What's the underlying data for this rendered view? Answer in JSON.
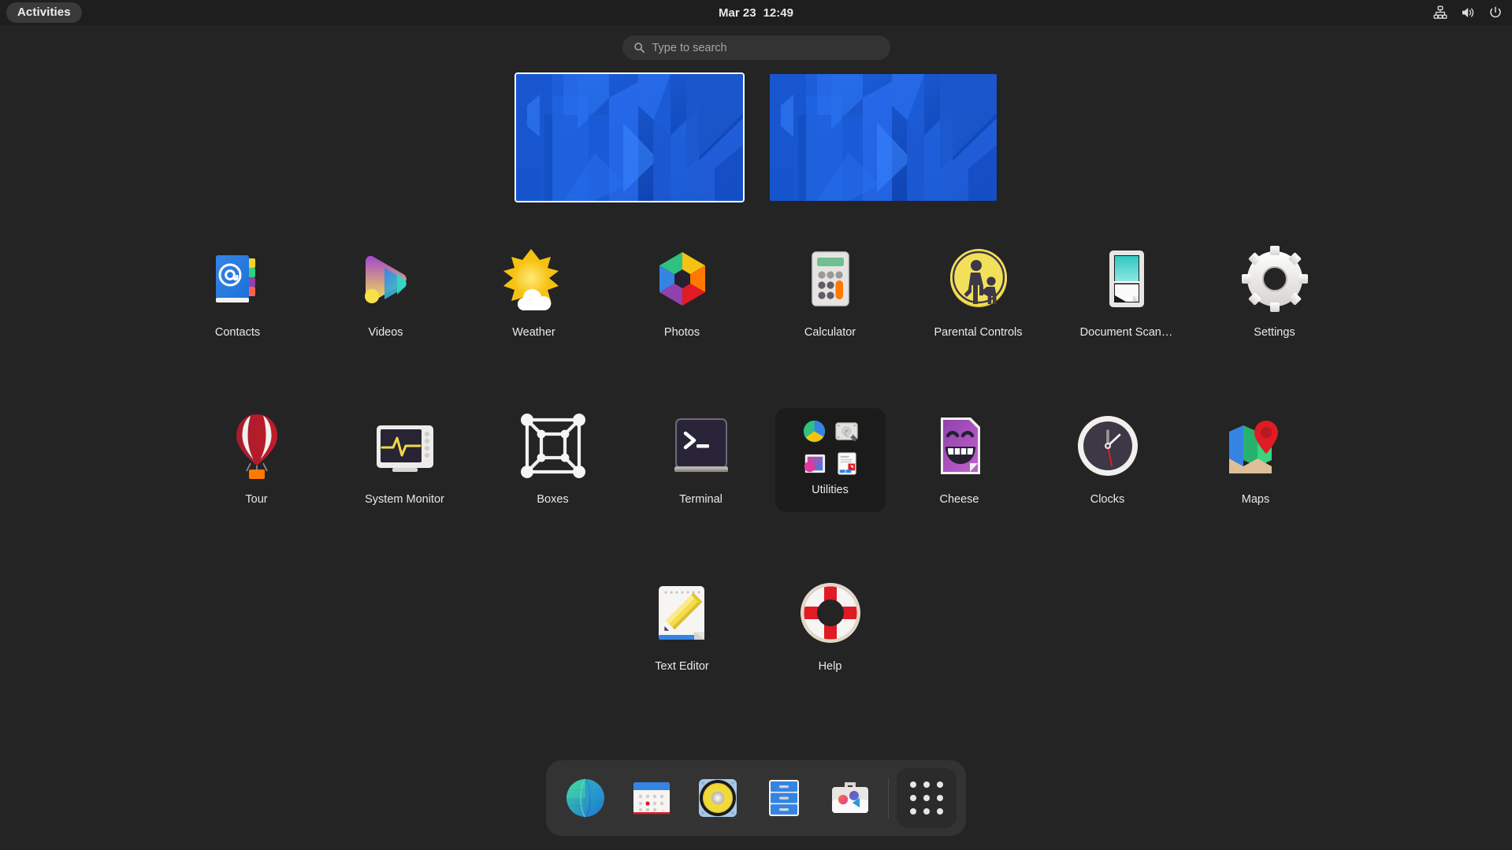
{
  "topbar": {
    "activities_label": "Activities",
    "clock_date": "Mar 23",
    "clock_time": "12:49",
    "tray_icons": [
      "network-wired-icon",
      "volume-icon",
      "power-icon"
    ]
  },
  "search": {
    "placeholder": "Type to search",
    "value": "",
    "icon": "search-icon"
  },
  "workspaces": [
    {
      "name": "workspace-1",
      "active": true
    },
    {
      "name": "workspace-2",
      "active": false
    }
  ],
  "app_grid": {
    "rows": [
      [
        {
          "label": "Contacts",
          "icon": "contacts-icon"
        },
        {
          "label": "Videos",
          "icon": "videos-icon"
        },
        {
          "label": "Weather",
          "icon": "weather-icon"
        },
        {
          "label": "Photos",
          "icon": "photos-icon"
        },
        {
          "label": "Calculator",
          "icon": "calculator-icon"
        },
        {
          "label": "Parental Controls",
          "icon": "parental-controls-icon"
        },
        {
          "label": "Document Scan…",
          "icon": "document-scanner-icon"
        },
        {
          "label": "Settings",
          "icon": "settings-gear-icon"
        }
      ],
      [
        {
          "label": "Tour",
          "icon": "tour-balloon-icon"
        },
        {
          "label": "System Monitor",
          "icon": "system-monitor-icon"
        },
        {
          "label": "Boxes",
          "icon": "boxes-icon"
        },
        {
          "label": "Terminal",
          "icon": "terminal-icon"
        },
        {
          "label": "Utilities",
          "icon": "utilities-folder-icon",
          "folder": true,
          "children": [
            "disk-usage-pie-icon",
            "disks-wrench-icon",
            "image-viewer-icon",
            "document-viewer-icon"
          ]
        },
        {
          "label": "Cheese",
          "icon": "cheese-icon"
        },
        {
          "label": "Clocks",
          "icon": "clocks-icon"
        },
        {
          "label": "Maps",
          "icon": "maps-icon"
        }
      ],
      [
        {
          "label": "Text Editor",
          "icon": "text-editor-icon"
        },
        {
          "label": "Help",
          "icon": "help-lifering-icon"
        }
      ]
    ]
  },
  "dash": {
    "items": [
      {
        "name": "web",
        "icon": "web-globe-icon"
      },
      {
        "name": "calendar",
        "icon": "calendar-icon"
      },
      {
        "name": "music",
        "icon": "music-speaker-icon"
      },
      {
        "name": "files",
        "icon": "files-cabinet-icon"
      },
      {
        "name": "software",
        "icon": "software-briefcase-icon"
      }
    ],
    "apps_button": "show-applications-icon"
  },
  "colors": {
    "desktop_bg": "#242424",
    "topbar_bg": "#1e1e1e",
    "dash_bg": "#333333",
    "search_bg": "#333333",
    "text": "#e9e9e9",
    "wallpaper_blue": "#1e60dd"
  }
}
